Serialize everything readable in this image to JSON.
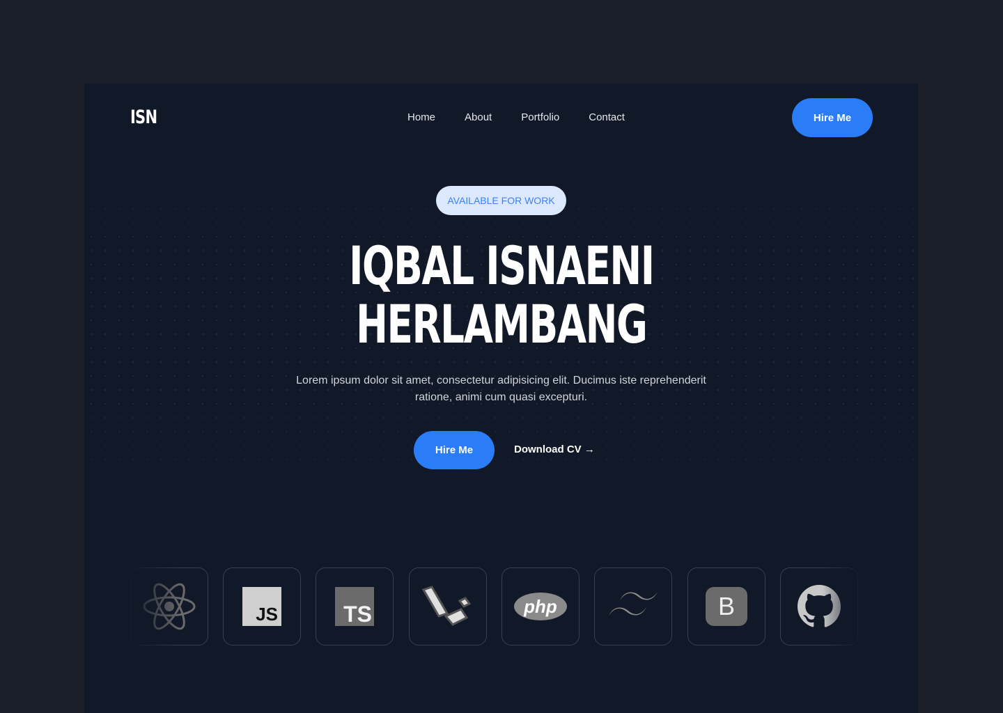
{
  "header": {
    "logo": "ISN",
    "nav": [
      "Home",
      "About",
      "Portfolio",
      "Contact"
    ],
    "hire_label": "Hire Me"
  },
  "hero": {
    "badge": "AVAILABLE FOR WORK",
    "title_line1": "IQBAL ISNAENI",
    "title_line2": "HERLAMBANG",
    "description": "Lorem ipsum dolor sit amet, consectetur adipisicing elit. Ducimus iste reprehenderit ratione, animi cum quasi excepturi.",
    "primary_cta": "Hire Me",
    "secondary_cta": "Download CV →"
  },
  "tech_stack": [
    {
      "icon": "react-icon"
    },
    {
      "icon": "javascript-icon",
      "text": "JS"
    },
    {
      "icon": "typescript-icon",
      "text": "TS"
    },
    {
      "icon": "laravel-icon"
    },
    {
      "icon": "php-icon",
      "text": "php"
    },
    {
      "icon": "tailwind-icon"
    },
    {
      "icon": "bootstrap-icon",
      "text": "B"
    },
    {
      "icon": "github-icon"
    }
  ],
  "colors": {
    "accent": "#2b7cf7",
    "background": "#111827",
    "badge_bg": "#dbe8ff"
  }
}
